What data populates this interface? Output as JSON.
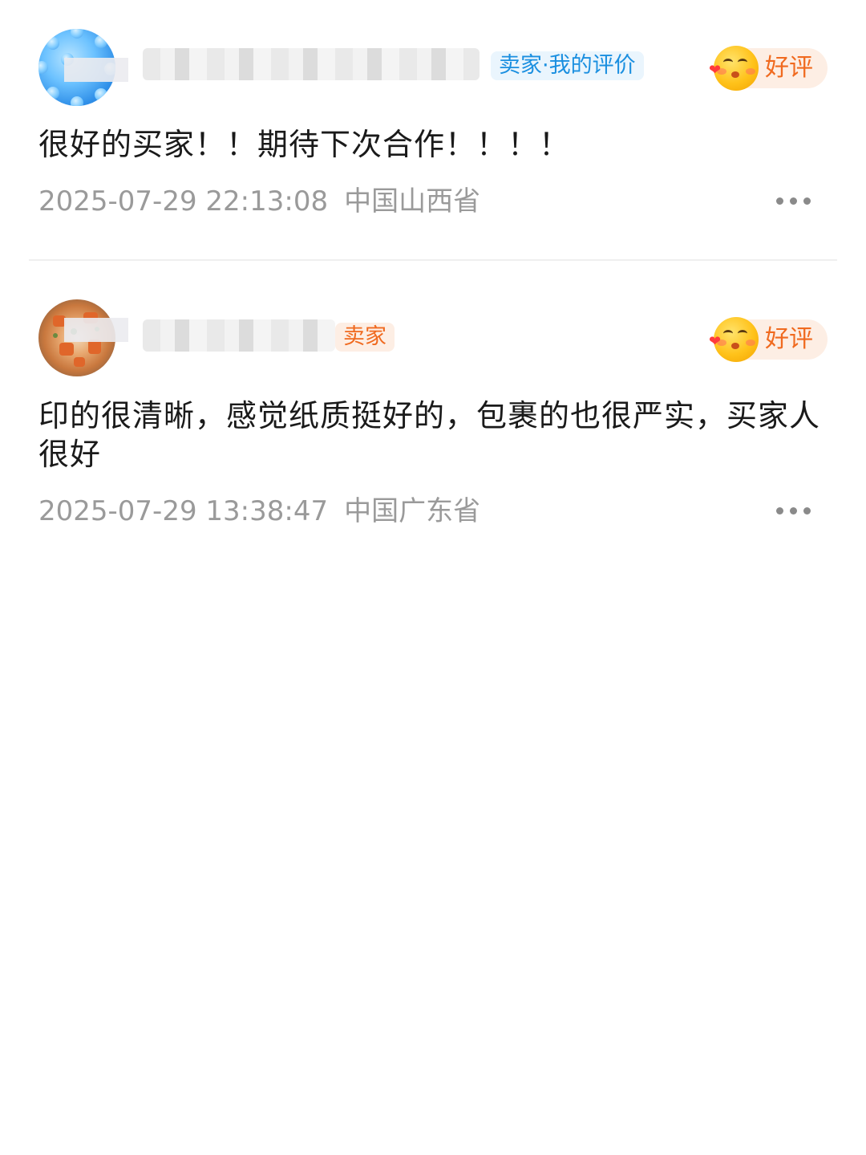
{
  "reviews": [
    {
      "tag": "卖家·我的评价",
      "rating_label": "好评",
      "comment": "很好的买家！！期待下次合作！！！！",
      "timestamp": "2025-07-29 22:13:08",
      "location": "中国山西省"
    },
    {
      "tag": "卖家",
      "rating_label": "好评",
      "comment": "印的很清晰，感觉纸质挺好的，包裹的也很严实，买家人很好",
      "timestamp": "2025-07-29 13:38:47",
      "location": "中国广东省"
    }
  ],
  "icons": {
    "rating": "smiling-face-emoji-icon",
    "more": "more-dots-icon"
  },
  "colors": {
    "tag_blue": "#1a8fe0",
    "tag_orange": "#f06a1f",
    "rating_badge": "#fdeee4",
    "meta_text": "#9a9a9a"
  }
}
